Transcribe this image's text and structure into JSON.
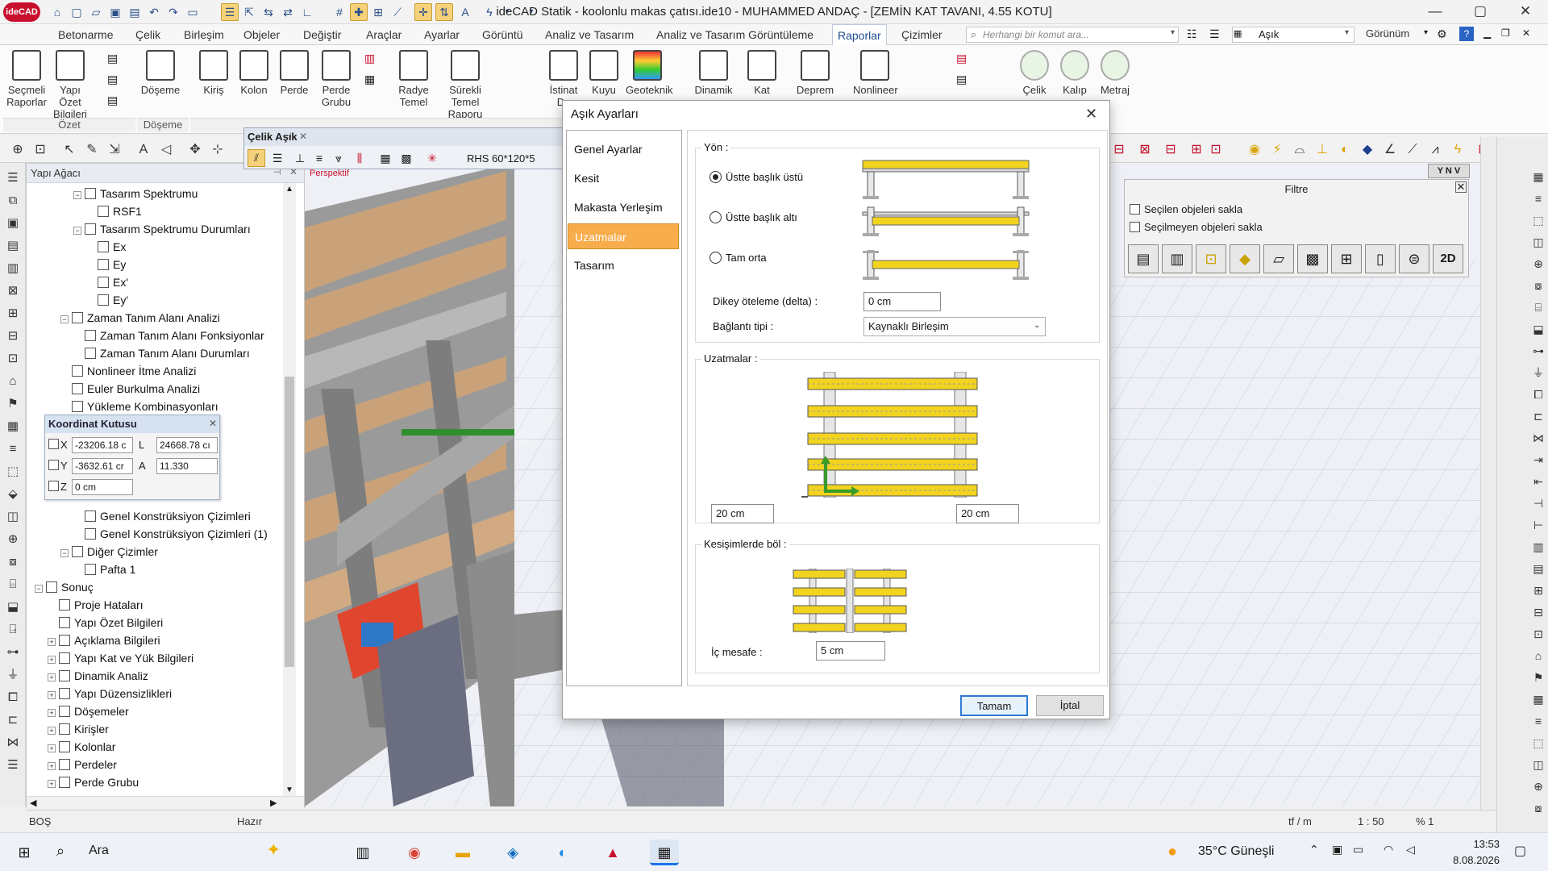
{
  "app": {
    "logo": "ideCAD",
    "title": "ideCAD Statik - koolonlu makas çatısı.ide10 - MUHAMMED ANDAÇ - [ZEMİN KAT TAVANI,  4.55 KOTU]"
  },
  "menu": {
    "tabs": [
      "Betonarme",
      "Çelik",
      "Birleşim",
      "Objeler",
      "Değiştir",
      "Araçlar",
      "Ayarlar",
      "Görüntü",
      "Analiz ve Tasarım",
      "Analiz ve Tasarım Görüntüleme",
      "Raporlar",
      "Çizimler"
    ],
    "active_tab": "Raporlar",
    "command_placeholder": "Herhangi bir komut ara...",
    "object_combo": "Aşık",
    "view_label": "Görünüm"
  },
  "ribbon": {
    "buttons": [
      {
        "label": "Seçmeli Raporlar"
      },
      {
        "label": "Yapı Özet Bilgileri"
      },
      {
        "label": "Döşeme"
      },
      {
        "label": "Kiriş"
      },
      {
        "label": "Kolon"
      },
      {
        "label": "Perde"
      },
      {
        "label": "Perde Grubu"
      },
      {
        "label": "Radye Temel"
      },
      {
        "label": "Sürekli Temel Raporu"
      },
      {
        "label": "İstinat Du"
      },
      {
        "label": "Kuyu"
      },
      {
        "label": "Geoteknik"
      },
      {
        "label": "Dinamik"
      },
      {
        "label": "Kat"
      },
      {
        "label": "Deprem"
      },
      {
        "label": "Nonlineer"
      },
      {
        "label": "Çelik"
      },
      {
        "label": "Kalıp"
      },
      {
        "label": "Metraj"
      }
    ],
    "groups": [
      "Özet",
      "Döşeme"
    ]
  },
  "celik_toolbar": {
    "title": "Çelik Aşık",
    "section": "RHS 60*120*5"
  },
  "tree": {
    "title": "Yapı Ağacı",
    "items": [
      {
        "label": "Tasarım Spektrumu",
        "level": 3,
        "expander": "−"
      },
      {
        "label": "RSF1",
        "level": 4,
        "expander": ""
      },
      {
        "label": "Tasarım Spektrumu Durumları",
        "level": 3,
        "expander": "−"
      },
      {
        "label": "Ex",
        "level": 4,
        "expander": ""
      },
      {
        "label": "Ey",
        "level": 4,
        "expander": ""
      },
      {
        "label": "Ex'",
        "level": 4,
        "expander": ""
      },
      {
        "label": "Ey'",
        "level": 4,
        "expander": ""
      },
      {
        "label": "Zaman Tanım Alanı Analizi",
        "level": 2,
        "expander": "−"
      },
      {
        "label": "Zaman Tanım Alanı Fonksiyonlar",
        "level": 3,
        "expander": ""
      },
      {
        "label": "Zaman Tanım Alanı Durumları",
        "level": 3,
        "expander": ""
      },
      {
        "label": "Nonlineer İtme Analizi",
        "level": 2,
        "expander": ""
      },
      {
        "label": "Euler Burkulma Analizi",
        "level": 2,
        "expander": ""
      },
      {
        "label": "Yükleme Kombinasyonları",
        "level": 2,
        "expander": ""
      }
    ],
    "items_lower": [
      {
        "label": "Genel Konstrüksiyon Çizimleri",
        "level": 3,
        "expander": ""
      },
      {
        "label": "Genel Konstrüksiyon Çizimleri (1)",
        "level": 3,
        "expander": ""
      },
      {
        "label": "Diğer Çizimler",
        "level": 2,
        "expander": "−"
      },
      {
        "label": "Pafta 1",
        "level": 3,
        "expander": ""
      },
      {
        "label": "Sonuç",
        "level": 0,
        "expander": "−"
      },
      {
        "label": "Proje Hataları",
        "level": 1,
        "expander": ""
      },
      {
        "label": "Yapı Özet Bilgileri",
        "level": 1,
        "expander": ""
      },
      {
        "label": "Açıklama Bilgileri",
        "level": 1,
        "expander": "+"
      },
      {
        "label": "Yapı Kat ve Yük Bilgileri",
        "level": 1,
        "expander": "+"
      },
      {
        "label": "Dinamik Analiz",
        "level": 1,
        "expander": "+"
      },
      {
        "label": "Yapı Düzensizlikleri",
        "level": 1,
        "expander": "+"
      },
      {
        "label": "Döşemeler",
        "level": 1,
        "expander": "+"
      },
      {
        "label": "Kirişler",
        "level": 1,
        "expander": "+"
      },
      {
        "label": "Kolonlar",
        "level": 1,
        "expander": "+"
      },
      {
        "label": "Perdeler",
        "level": 1,
        "expander": "+"
      },
      {
        "label": "Perde Grubu",
        "level": 1,
        "expander": "+"
      }
    ]
  },
  "coord_box": {
    "title": "Koordinat Kutusu",
    "x_label": "X",
    "x_value": "-23206.18 c",
    "y_label": "Y",
    "y_value": "-3632.61 cr",
    "z_label": "Z",
    "z_value": "0 cm",
    "l_label": "L",
    "l_value": "24668.78 cı",
    "a_label": "A",
    "a_value": "11.330"
  },
  "viewport": {
    "label": "Perspektif"
  },
  "filtre": {
    "title": "Filtre",
    "option1": "Seçilen objeleri sakla",
    "option2": "Seçilmeyen objeleri sakla",
    "btn_2d": "2D"
  },
  "dialog": {
    "title": "Aşık Ayarları",
    "nav": [
      "Genel Ayarlar",
      "Kesit",
      "Makasta Yerleşim",
      "Uzatmalar",
      "Tasarım"
    ],
    "active_nav": "Uzatmalar",
    "yon_title": "Yön :",
    "radio_options": [
      "Üstte başlık üstü",
      "Üstte başlık altı",
      "Tam orta"
    ],
    "radio_selected": 0,
    "dikey_label": "Dikey öteleme (delta) :",
    "dikey_value": "0 cm",
    "baglanti_label": "Bağlantı tipi :",
    "baglanti_value": "Kaynaklı Birleşim",
    "uzatmalar_title": "Uzatmalar :",
    "uzatma_left": "20 cm",
    "uzatma_right": "20 cm",
    "kesisim_title": "Kesişimlerde böl :",
    "ic_mesafe_label": "İç mesafe :",
    "ic_mesafe_value": "5 cm",
    "ok_label": "Tamam",
    "cancel_label": "İptal"
  },
  "status": {
    "left": "BOŞ",
    "mid": "Hazır",
    "unit": "tf / m",
    "scale": "1 : 50",
    "zoom": "% 1"
  },
  "taskbar": {
    "search_label": "Ara",
    "weather": "35°C  Güneşli",
    "time": "13:53",
    "date": "8.08.2026"
  },
  "colors": {
    "accent_tab": "#1d4b8f",
    "active_nav": "#f7ad4b",
    "beam_yellow": "#f2d320",
    "truss_wood": "#c9a27a"
  }
}
